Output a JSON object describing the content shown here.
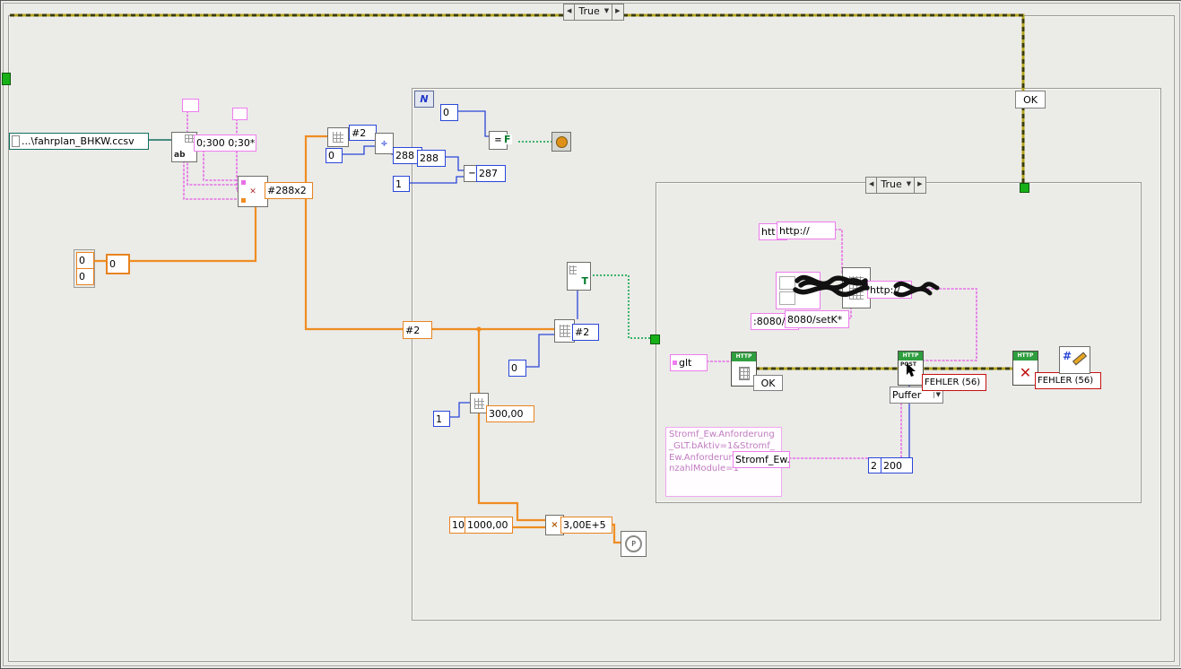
{
  "colors": {
    "wire_orange": "#ef8d22",
    "wire_blue": "#2a47d8",
    "wire_pink": "#e66fe6",
    "wire_green": "#00a23c",
    "wire_error": "#b3a51f",
    "http_green": "#2f9e3f",
    "error_red": "#c41212",
    "path_teal": "#0e6e5e"
  },
  "arrows": {
    "left": "◀",
    "down": "▼",
    "right": "▶"
  },
  "icons": {
    "divide": "÷",
    "subtract": "−",
    "equals": "=",
    "multiply": "×",
    "close": "✕"
  },
  "outer_case": {
    "selector": "True",
    "ok": "OK"
  },
  "file_block": {
    "path": "...\\fahrplan_BHKW.ccsv",
    "format_spec": "0;300 0;30*",
    "dims": "#288x2",
    "zero1": "0",
    "zero2": "0",
    "zero3": "0",
    "read_icon_text": "ab"
  },
  "pre_loop": {
    "hash2": "#2",
    "zero": "0",
    "out_288": "288",
    "in_288": "288",
    "one": "1",
    "c287": "287",
    "hash2_tunnel": "#2"
  },
  "loop": {
    "count": "N",
    "zero_top": "0",
    "false_flag": "F",
    "to_bool": "T",
    "hash2": "#2",
    "zero_mid": "0",
    "one": "1",
    "v300": "300,00",
    "ten": "10",
    "v1000": "1000,00",
    "v3e5": "3,00E+5",
    "p": "P"
  },
  "http_case": {
    "selector": "True",
    "http_frag": "htt",
    "http_const": "http://",
    "url_frag": ":8080/s",
    "url_const": "8080/setK*",
    "url_out": "http://",
    "glt": "glt",
    "badge": "HTTP",
    "post": "POST",
    "ok": "OK",
    "puffer": "Puffer",
    "fehler1": "FEHLER (56)",
    "fehler2": "FEHLER (56)",
    "body": "Stromf_Ew.*",
    "two": "2",
    "c200": "200",
    "hash": "#",
    "comment": "Stromf_Ew.Anforderung_GLT.bAktiv=1&Stromf_Ew.Anforderung_GLT.bAnzahlModule=1"
  }
}
